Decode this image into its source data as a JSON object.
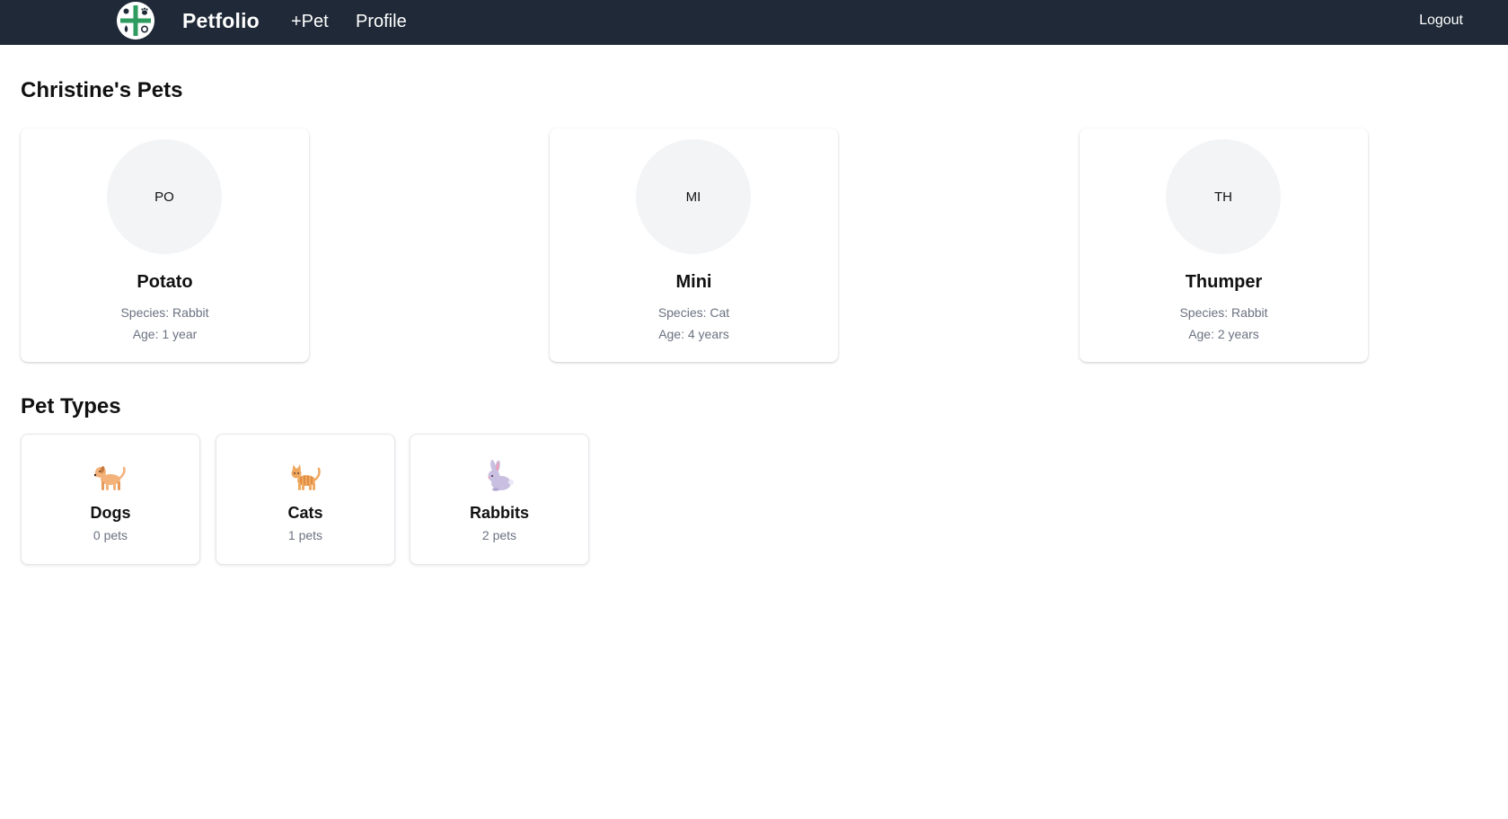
{
  "navbar": {
    "brand": "Petfolio",
    "logo_icon": "petfolio-logo-icon",
    "links": {
      "add_pet": "+Pet",
      "profile": "Profile",
      "logout": "Logout"
    },
    "background": "#1f2937"
  },
  "pets_section": {
    "title": "Christine's Pets",
    "pets": [
      {
        "initials": "PO",
        "name": "Potato",
        "species": "Species: Rabbit",
        "age": "Age: 1 year"
      },
      {
        "initials": "MI",
        "name": "Mini",
        "species": "Species: Cat",
        "age": "Age: 4 years"
      },
      {
        "initials": "TH",
        "name": "Thumper",
        "species": "Species: Rabbit",
        "age": "Age: 2 years"
      }
    ]
  },
  "types_section": {
    "title": "Pet Types",
    "types": [
      {
        "icon": "dog-icon",
        "name": "Dogs",
        "count": "0 pets"
      },
      {
        "icon": "cat-icon",
        "name": "Cats",
        "count": "1 pets"
      },
      {
        "icon": "rabbit-icon",
        "name": "Rabbits",
        "count": "2 pets"
      }
    ]
  },
  "colors": {
    "accent_green": "#2e9b5f",
    "muted_text": "#6b7280",
    "avatar_bg": "#f3f4f6"
  }
}
